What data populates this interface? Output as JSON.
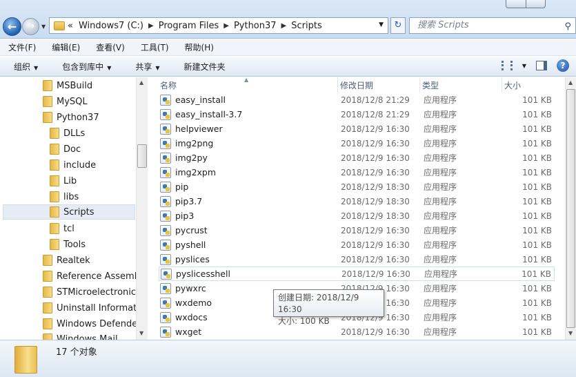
{
  "address": {
    "overflow": "«",
    "crumbs": [
      "Windows7 (C:)",
      "Program Files",
      "Python37",
      "Scripts"
    ],
    "search_placeholder": "搜索 Scripts"
  },
  "menu": [
    "文件(F)",
    "编辑(E)",
    "查看(V)",
    "工具(T)",
    "帮助(H)"
  ],
  "toolbar": {
    "organize": "组织",
    "include_library": "包含到库中",
    "share": "共享",
    "new_folder": "新建文件夹"
  },
  "tree": {
    "items": [
      {
        "label": "MSBuild",
        "level": 1
      },
      {
        "label": "MySQL",
        "level": 1
      },
      {
        "label": "Python37",
        "level": 1
      },
      {
        "label": "DLLs",
        "level": 2
      },
      {
        "label": "Doc",
        "level": 2
      },
      {
        "label": "include",
        "level": 2
      },
      {
        "label": "Lib",
        "level": 2
      },
      {
        "label": "libs",
        "level": 2
      },
      {
        "label": "Scripts",
        "level": 2,
        "selected": true
      },
      {
        "label": "tcl",
        "level": 2
      },
      {
        "label": "Tools",
        "level": 2
      },
      {
        "label": "Realtek",
        "level": 1
      },
      {
        "label": "Reference Assembli",
        "level": 1
      },
      {
        "label": "STMicroelectronics",
        "level": 1
      },
      {
        "label": "Uninstall Informatio",
        "level": 1
      },
      {
        "label": "Windows Defender",
        "level": 1
      },
      {
        "label": "Windows Mail",
        "level": 1
      }
    ]
  },
  "columns": {
    "name": "名称",
    "date": "修改日期",
    "type": "类型",
    "size": "大小"
  },
  "files": [
    {
      "name": "easy_install",
      "date": "2018/12/8 21:29",
      "type": "应用程序",
      "size": "101 KB"
    },
    {
      "name": "easy_install-3.7",
      "date": "2018/12/8 21:29",
      "type": "应用程序",
      "size": "101 KB"
    },
    {
      "name": "helpviewer",
      "date": "2018/12/9 16:30",
      "type": "应用程序",
      "size": "101 KB"
    },
    {
      "name": "img2png",
      "date": "2018/12/9 16:30",
      "type": "应用程序",
      "size": "101 KB"
    },
    {
      "name": "img2py",
      "date": "2018/12/9 16:30",
      "type": "应用程序",
      "size": "101 KB"
    },
    {
      "name": "img2xpm",
      "date": "2018/12/9 16:30",
      "type": "应用程序",
      "size": "101 KB"
    },
    {
      "name": "pip",
      "date": "2018/12/9 18:30",
      "type": "应用程序",
      "size": "101 KB"
    },
    {
      "name": "pip3.7",
      "date": "2018/12/9 18:30",
      "type": "应用程序",
      "size": "101 KB"
    },
    {
      "name": "pip3",
      "date": "2018/12/9 18:30",
      "type": "应用程序",
      "size": "101 KB"
    },
    {
      "name": "pycrust",
      "date": "2018/12/9 16:30",
      "type": "应用程序",
      "size": "101 KB"
    },
    {
      "name": "pyshell",
      "date": "2018/12/9 16:30",
      "type": "应用程序",
      "size": "101 KB"
    },
    {
      "name": "pyslices",
      "date": "2018/12/9 16:30",
      "type": "应用程序",
      "size": "101 KB"
    },
    {
      "name": "pyslicesshell",
      "date": "2018/12/9 16:30",
      "type": "应用程序",
      "size": "101 KB",
      "hover": true
    },
    {
      "name": "pywxrc",
      "date": "2018/12/9 16:30",
      "type": "应用程序",
      "size": "101 KB"
    },
    {
      "name": "wxdemo",
      "date": "2018/12/9 16:30",
      "type": "应用程序",
      "size": "101 KB"
    },
    {
      "name": "wxdocs",
      "date": "2018/12/9 16:30",
      "type": "应用程序",
      "size": "101 KB"
    },
    {
      "name": "wxget",
      "date": "2018/12/9 16:30",
      "type": "应用程序",
      "size": "101 KB"
    }
  ],
  "tooltip": {
    "created": "创建日期: 2018/12/9 16:30",
    "size": "大小: 100 KB"
  },
  "status": {
    "count": "17 个对象"
  }
}
